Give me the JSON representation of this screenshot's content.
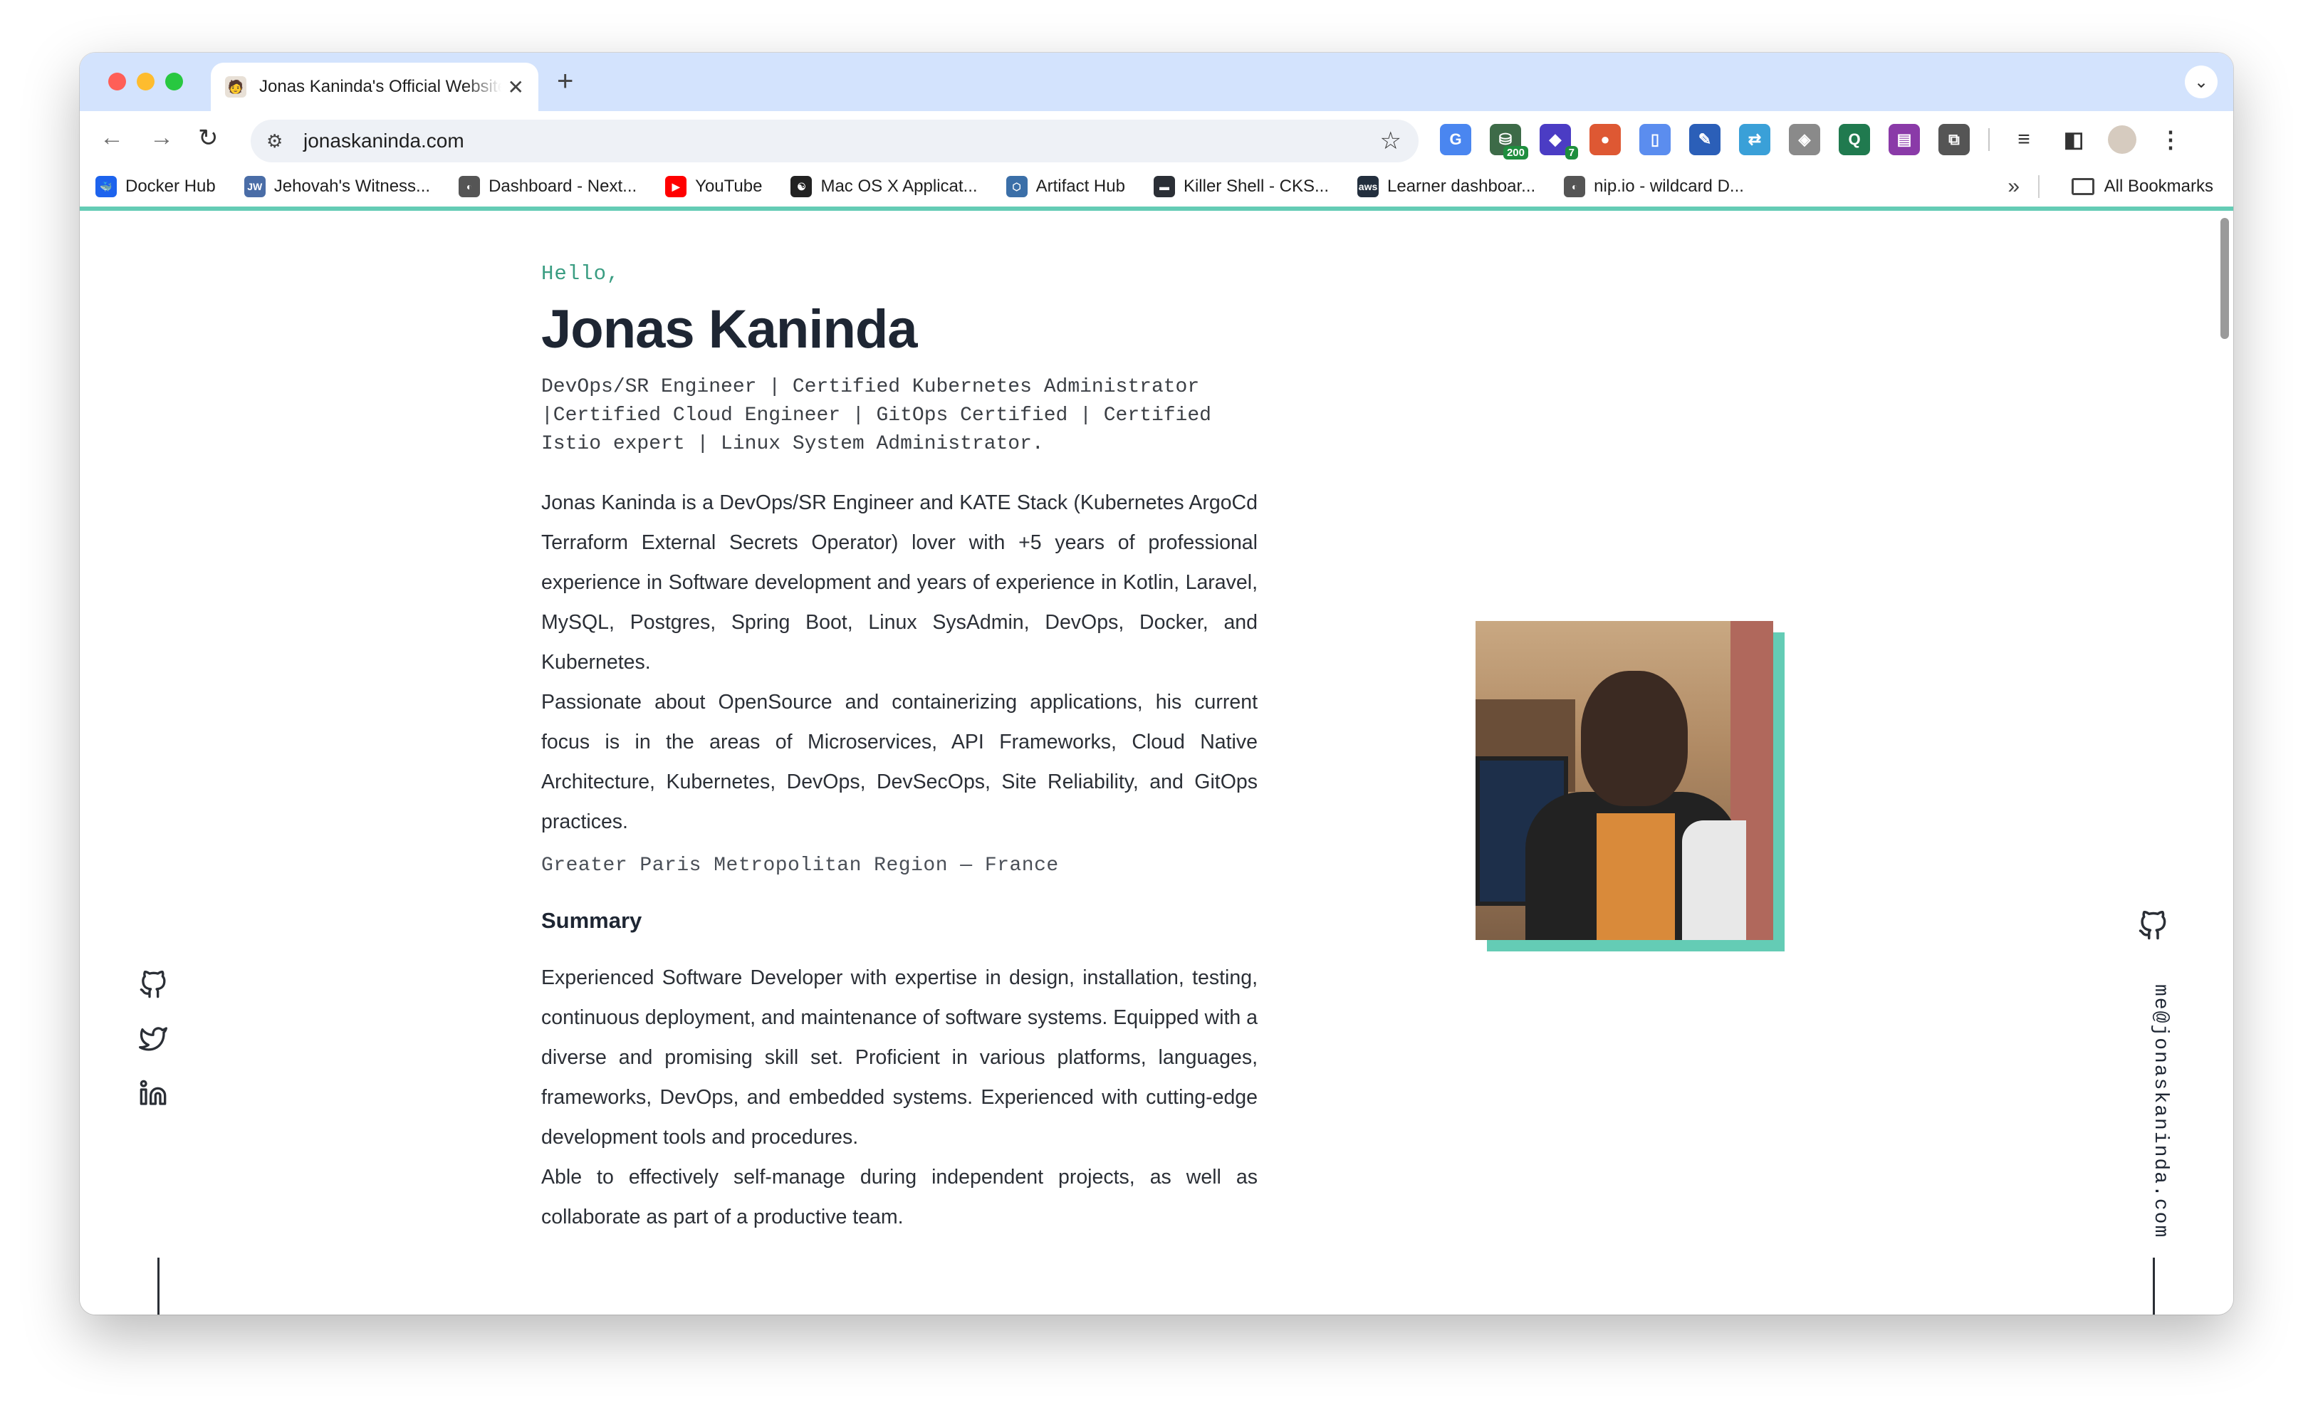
{
  "browser": {
    "tab": {
      "title": "Jonas Kaninda's Official Website",
      "close": "✕",
      "favicon": "🧑"
    },
    "new_tab": "+",
    "tab_menu": "⌄",
    "nav": {
      "back": "←",
      "forward": "→",
      "reload": "↻"
    },
    "omnibox": {
      "site_info": "⚙",
      "url": "jonaskaninda.com",
      "star": "☆"
    },
    "extensions": [
      {
        "name": "google-translate-icon",
        "glyph": "G",
        "color": "#4a86f0"
      },
      {
        "name": "extension-200-icon",
        "glyph": "⛁",
        "color": "#3d6b48",
        "badge": "200"
      },
      {
        "name": "extension-7-icon",
        "glyph": "◆",
        "color": "#4b3cc4",
        "badge": "7"
      },
      {
        "name": "duckduckgo-icon",
        "glyph": "●",
        "color": "#de5833"
      },
      {
        "name": "phone-icon",
        "glyph": "▯",
        "color": "#5b8def"
      },
      {
        "name": "extension-blue-icon",
        "glyph": "✎",
        "color": "#2b5fb8"
      },
      {
        "name": "extension-sync-icon",
        "glyph": "⇄",
        "color": "#3aa0d8"
      },
      {
        "name": "git-icon",
        "glyph": "◈",
        "color": "#8a8a8a"
      },
      {
        "name": "extension-green-icon",
        "glyph": "Q",
        "color": "#207a4f"
      },
      {
        "name": "extension-purple-icon",
        "glyph": "▤",
        "color": "#8a3aa8"
      },
      {
        "name": "extensions-puzzle-icon",
        "glyph": "⧉",
        "color": "#555555"
      }
    ],
    "toolbar_right": {
      "reading_list": "≡",
      "side_panel": "◧",
      "menu": "⋮"
    },
    "bookmarks": [
      {
        "label": "Docker Hub",
        "icon": "🐳",
        "color": "#1d63ed"
      },
      {
        "label": "Jehovah's Witness...",
        "icon": "JW",
        "color": "#4a6da7"
      },
      {
        "label": "Dashboard - Next...",
        "icon": "◐",
        "color": "#555555"
      },
      {
        "label": "YouTube",
        "icon": "▶",
        "color": "#ff0000"
      },
      {
        "label": "Mac OS X Applicat...",
        "icon": "☯",
        "color": "#222222"
      },
      {
        "label": "Artifact Hub",
        "icon": "⬡",
        "color": "#3b6fa8"
      },
      {
        "label": "Killer Shell - CKS...",
        "icon": "▬",
        "color": "#2b2f36"
      },
      {
        "label": "Learner dashboar...",
        "icon": "aws",
        "color": "#232f3e"
      },
      {
        "label": "nip.io - wildcard D...",
        "icon": "◐",
        "color": "#555555"
      }
    ],
    "bookmarks_more": "»",
    "all_bookmarks": "All Bookmarks"
  },
  "page": {
    "greeting": "Hello,",
    "name": "Jonas Kaninda",
    "tagline": "DevOps/SR Engineer | Certified Kubernetes Administrator |Certified Cloud Engineer | GitOps Certified | Certified Istio expert | Linux System Administrator.",
    "bio_p1": "Jonas Kaninda is a DevOps/SR Engineer and KATE Stack (Kubernetes ArgoCd Terraform External Secrets Operator) lover with +5 years of professional experience in Software development and years of experience in Kotlin, Laravel, MySQL, Postgres, Spring Boot, Linux SysAdmin, DevOps, Docker, and Kubernetes.",
    "bio_p2": "Passionate about OpenSource and containerizing applications, his current focus is in the areas of Microservices, API Frameworks, Cloud Native Architecture, Kubernetes, DevOps, DevSecOps, Site Reliability, and GitOps practices.",
    "location": "Greater Paris Metropolitan Region — France",
    "summary_title": "Summary",
    "summary_p1": "Experienced Software Developer with expertise in design, installation, testing, continuous deployment, and maintenance of software systems. Equipped with a diverse and promising skill set. Proficient in various platforms, languages, frameworks, DevOps, and embedded systems. Experienced with cutting-edge development tools and procedures.",
    "summary_p2": "Able to effectively self-manage during independent projects, as well as collaborate as part of a productive team.",
    "email": "me@jonaskaninda.com"
  },
  "colors": {
    "accent": "#64ccb5",
    "greeting": "#3a9d82",
    "heading": "#1e2633"
  }
}
